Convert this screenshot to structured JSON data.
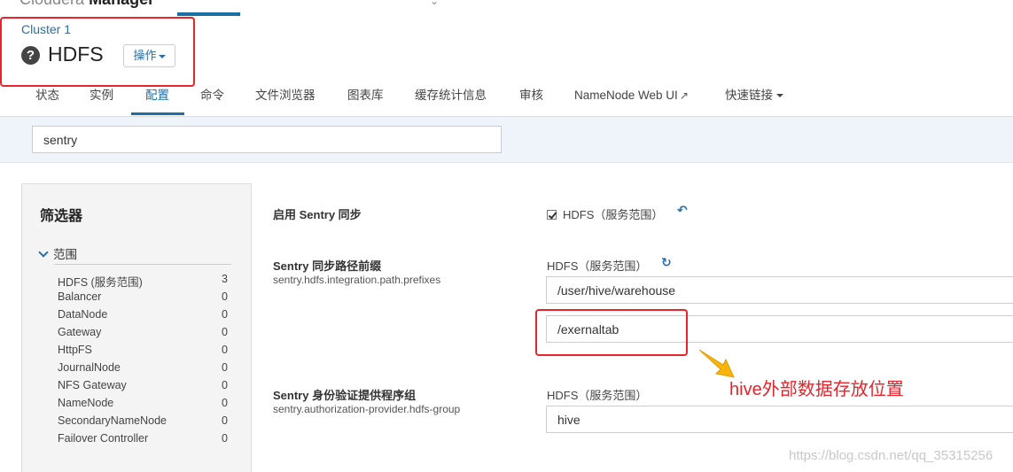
{
  "header": {
    "brand_light": "Cloudera",
    "brand_bold": "Manager",
    "cluster_link": "Cluster 1",
    "service_name": "HDFS",
    "actions_label": "操作"
  },
  "tabs": [
    {
      "label": "状态",
      "active": false
    },
    {
      "label": "实例",
      "active": false
    },
    {
      "label": "配置",
      "active": true
    },
    {
      "label": "命令",
      "active": false
    },
    {
      "label": "文件浏览器",
      "active": false
    },
    {
      "label": "图表库",
      "active": false
    },
    {
      "label": "缓存统计信息",
      "active": false
    },
    {
      "label": "审核",
      "active": false
    },
    {
      "label": "NameNode Web UI",
      "active": false
    },
    {
      "label": "快速链接",
      "active": false
    }
  ],
  "search": {
    "value": "sentry"
  },
  "filters": {
    "title": "筛选器",
    "scope_label": "范围",
    "items": [
      {
        "name": "HDFS (服务范围)",
        "count": "3"
      },
      {
        "name": "Balancer",
        "count": "0"
      },
      {
        "name": "DataNode",
        "count": "0"
      },
      {
        "name": "Gateway",
        "count": "0"
      },
      {
        "name": "HttpFS",
        "count": "0"
      },
      {
        "name": "JournalNode",
        "count": "0"
      },
      {
        "name": "NFS Gateway",
        "count": "0"
      },
      {
        "name": "NameNode",
        "count": "0"
      },
      {
        "name": "SecondaryNameNode",
        "count": "0"
      },
      {
        "name": "Failover Controller",
        "count": "0"
      }
    ]
  },
  "settings": {
    "sentry_sync": {
      "label": "启用 Sentry 同步",
      "scope": "HDFS（服务范围）",
      "checked": true
    },
    "path_prefixes": {
      "label": "Sentry 同步路径前缀",
      "key": "sentry.hdfs.integration.path.prefixes",
      "scope": "HDFS（服务范围）",
      "values": [
        "/user/hive/warehouse",
        "/exernaltab"
      ]
    },
    "provider_group": {
      "label": "Sentry 身份验证提供程序组",
      "key": "sentry.authorization-provider.hdfs-group",
      "scope": "HDFS（服务范围）",
      "value": "hive"
    }
  },
  "annotation": {
    "text": "hive外部数据存放位置",
    "color": "#e8232a"
  },
  "watermark": "https://blog.csdn.net/qq_35315256",
  "colors": {
    "accent": "#1b6fa8",
    "link": "#2a6ea8",
    "search_band": "#eef4fa"
  }
}
